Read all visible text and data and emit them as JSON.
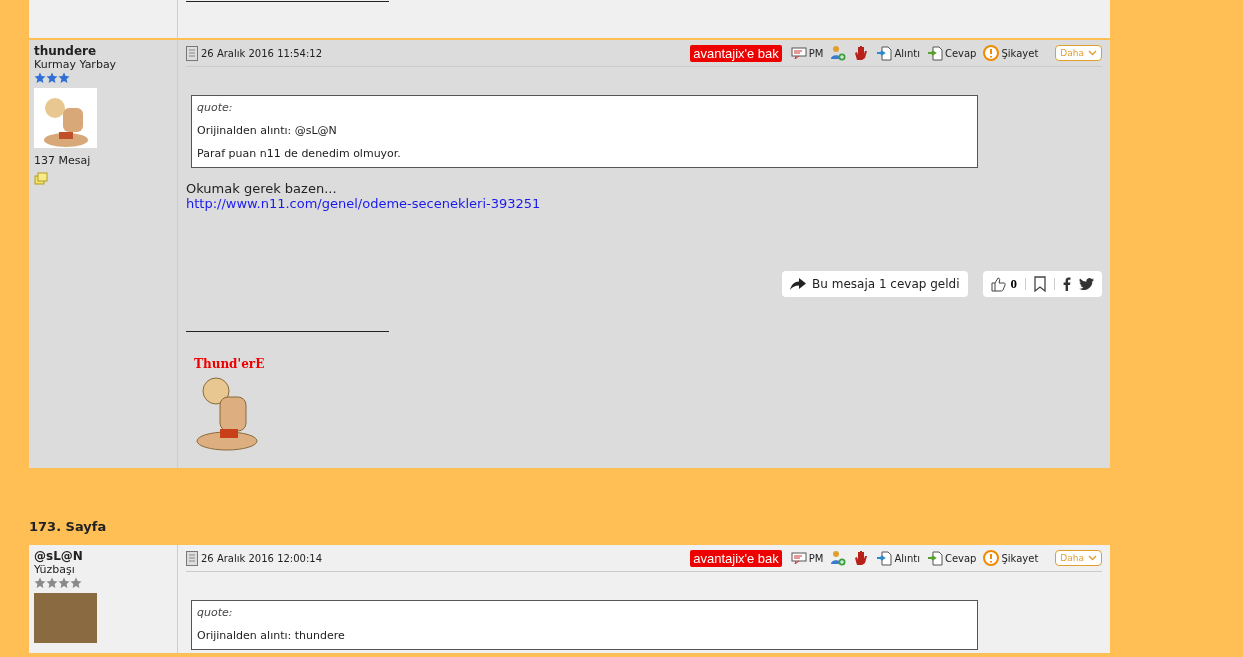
{
  "posts": [
    {
      "kind": "partial",
      "highlighted": false
    },
    {
      "kind": "full",
      "highlighted": true,
      "author": "thundere",
      "rank": "Kurmay Yarbay",
      "stars": 3,
      "color": "#2f6fd6",
      "avatar": {
        "kind": "cartoon"
      },
      "message_count": "137 Mesaj",
      "date": "26 Aralık 2016 11:54:12",
      "promo": "avantajix'e bak",
      "actions": [
        {
          "kind": "pm",
          "label": "PM"
        },
        {
          "kind": "add-friend"
        },
        {
          "kind": "block"
        },
        {
          "kind": "quote",
          "label": "Alıntı"
        },
        {
          "kind": "reply",
          "label": "Cevap"
        },
        {
          "kind": "report",
          "label": "Şikayet"
        }
      ],
      "more": "Daha",
      "quote": {
        "title": "quote:",
        "source": "Orijinalden alıntı: @sL@N",
        "text": "Paraf puan n11 de denedim olmuyor."
      },
      "body": [
        "Okumak gerek bazen..."
      ],
      "link": "http://www.n11.com/genel/odeme-secenekleri-393251",
      "replies": "Bu mesaja 1 cevap geldi",
      "likes": "0",
      "signature": "Thund'erE"
    },
    {
      "kind": "full",
      "highlighted": false,
      "page_heading": "173. Sayfa",
      "author": "@sL@N",
      "rank": "Yüzbaşı",
      "stars": 4,
      "color": "#8a8a8a",
      "avatar": {
        "kind": "photo"
      },
      "date": "26 Aralık 2016 12:00:14",
      "promo": "avantajix'e bak",
      "actions": [
        {
          "kind": "pm",
          "label": "PM"
        },
        {
          "kind": "add-friend"
        },
        {
          "kind": "block"
        },
        {
          "kind": "quote",
          "label": "Alıntı"
        },
        {
          "kind": "reply",
          "label": "Cevap"
        },
        {
          "kind": "report",
          "label": "Şikayet"
        }
      ],
      "more": "Daha",
      "quote": {
        "title": "quote:",
        "source": "Orijinalden alıntı: thundere"
      }
    }
  ]
}
